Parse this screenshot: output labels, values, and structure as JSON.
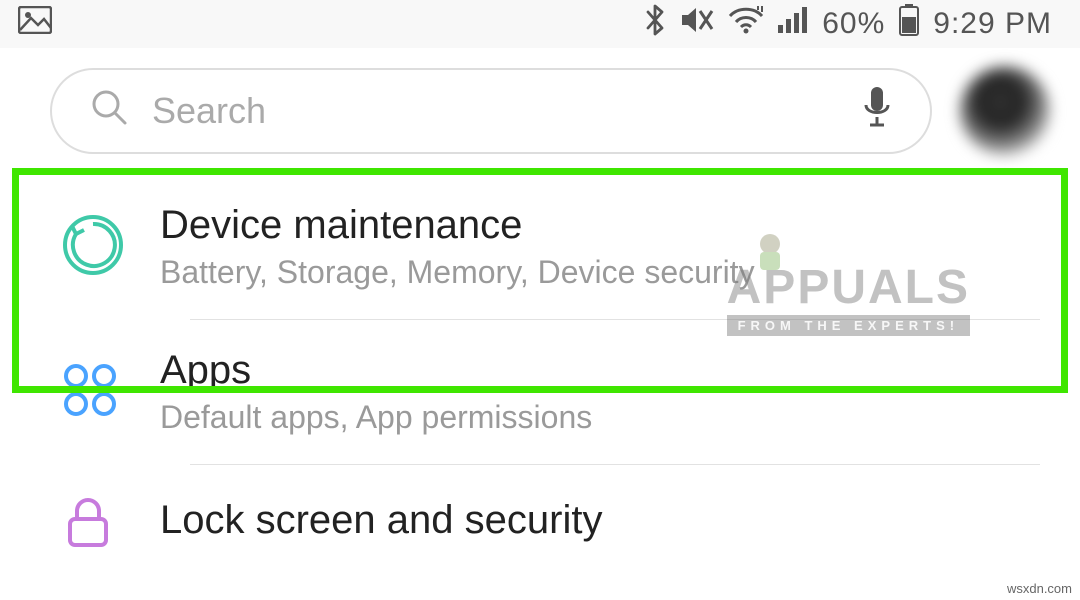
{
  "status": {
    "battery_pct": "60%",
    "time": "9:29 PM"
  },
  "search": {
    "placeholder": "Search"
  },
  "items": [
    {
      "title": "Device maintenance",
      "subtitle": "Battery, Storage, Memory, Device security"
    },
    {
      "title": "Apps",
      "subtitle": "Default apps, App permissions"
    },
    {
      "title": "Lock screen and security",
      "subtitle": ""
    }
  ],
  "watermark": {
    "brand": "APPUALS",
    "tag": "FROM THE EXPERTS!"
  },
  "footer_credit": "wsxdn.com"
}
